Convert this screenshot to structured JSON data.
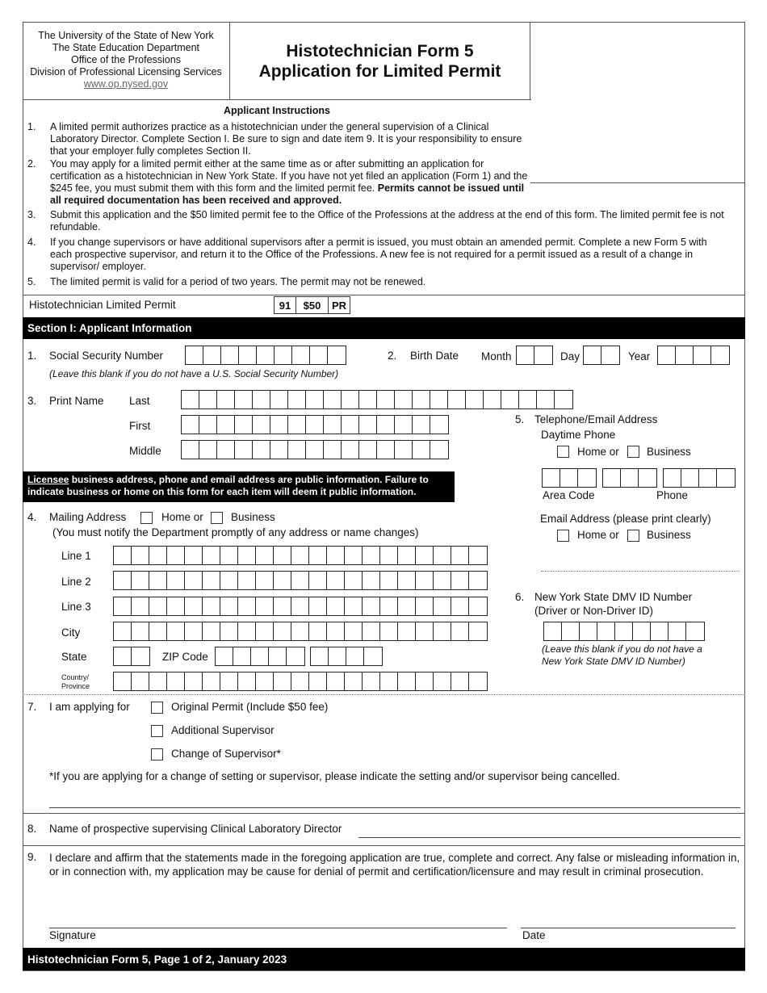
{
  "header": {
    "org_lines": [
      "The University of the State of New York",
      "The State Education Department",
      "Office of the Professions",
      "Division of Professional Licensing Services"
    ],
    "website": "www.op.nysed.gov",
    "title_line1": "Histotechnician Form 5",
    "title_line2": "Application for Limited Permit"
  },
  "instructions": {
    "title": "Applicant Instructions",
    "items": [
      {
        "num": "1.",
        "text": "A limited permit authorizes practice as a histotechnician under the general supervision of a Clinical Laboratory Director. Complete Section I. Be sure to sign and date item 9. It is your responsibility to ensure that your employer fully completes Section II."
      },
      {
        "num": "2.",
        "text": "You may apply for a limited permit either at the same time as or after submitting an application  for certification as a histotechnician in New York State. If you have not yet filed an application (Form 1) and the $245 fee, you must submit them with this form and the limited permit fee.",
        "bold": "Permits cannot be issued until all required documentation has been received and approved."
      },
      {
        "num": "3.",
        "text": "Submit this application and the $50 limited permit fee to the Office of the Professions at the address at the end of this form. The limited permit fee is not refundable."
      },
      {
        "num": "4.",
        "text": "If you change supervisors or have additional supervisors after a permit is issued, you must obtain an amended permit. Complete a new Form 5 with each prospective supervisor, and return it to the Office of the Professions. A new fee is not required for a permit issued as a result of a change in supervisor/ employer."
      },
      {
        "num": "5.",
        "text": "The limited permit is valid for a period of two years. The permit may not be renewed."
      }
    ]
  },
  "permit_row": {
    "label": "Histotechnician Limited Permit",
    "code": "91",
    "fee": "$50",
    "type": "PR"
  },
  "section1": {
    "title": "Section I: Applicant Information",
    "ssn": {
      "num": "1.",
      "label": "Social Security Number",
      "note": "(Leave this blank if you do not have a U.S. Social Security Number)"
    },
    "birth": {
      "num": "2.",
      "label": "Birth Date",
      "month": "Month",
      "day": "Day",
      "year": "Year"
    },
    "name": {
      "num": "3.",
      "label": "Print Name",
      "last": "Last",
      "first": "First",
      "middle": "Middle"
    },
    "notice": {
      "underlined": "Licensee",
      "rest": " business address, phone and email address are public information. Failure to indicate business or home on this form for each item will deem it public information."
    },
    "mailing": {
      "num": "4.",
      "label": "Mailing Address",
      "home": "Home or",
      "business": "Business",
      "note": "(You must notify the Department promptly of any address or name changes)",
      "line1": "Line 1",
      "line2": "Line 2",
      "line3": "Line 3",
      "city": "City",
      "state": "State",
      "zip": "ZIP Code",
      "country1": "Country/",
      "country2": "Province"
    },
    "contact": {
      "num": "5.",
      "label": "Telephone/Email Address",
      "daytime": "Daytime Phone",
      "home": "Home or",
      "business": "Business",
      "area_code": "Area Code",
      "phone": "Phone",
      "email_label": "Email Address (please print clearly)"
    },
    "dmv": {
      "num": "6.",
      "label1": "New York State DMV ID Number",
      "label2": "(Driver or Non-Driver ID)",
      "note1": "(Leave this blank if you do not have a",
      "note2": "New York State DMV ID Number)"
    },
    "applying": {
      "num": "7.",
      "label": "I am applying for",
      "options": [
        "Original Permit (Include $50 fee)",
        "Additional Supervisor",
        "Change of Supervisor*"
      ],
      "note": "*If you are applying for a change of setting or supervisor, please indicate the setting and/or supervisor being cancelled."
    },
    "director": {
      "num": "8.",
      "label": "Name of prospective supervising Clinical Laboratory Director"
    },
    "declaration": {
      "num": "9.",
      "text": "I declare and affirm that the statements made in the foregoing application are true, complete and correct. Any false or misleading information in, or in connection with, my application may be cause for denial of permit and certification/licensure and may result in criminal prosecution.",
      "signature": "Signature",
      "date": "Date"
    }
  },
  "footer": "Histotechnician Form 5, Page 1 of 2, January 2023"
}
